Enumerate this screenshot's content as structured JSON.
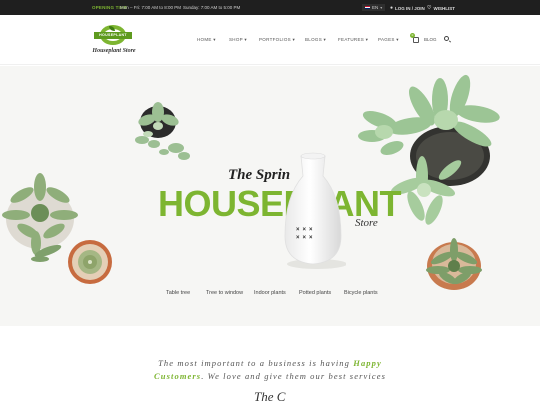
{
  "topbar": {
    "hours_title": "OPENING TIME",
    "hours_week": "Mon – Fri: 7:00 AM to 8:00 PM",
    "hours_weekend": "Sunday: 7:00 AM to 5:00 PM",
    "language": "EN",
    "login_label": "LOG IN / JOIN",
    "wishlist_label": "WISHLIST"
  },
  "header": {
    "logo_badge": "HOUSEPLANT",
    "logo_text": "Houseplant Store",
    "nav": [
      {
        "label": "HOME ▾"
      },
      {
        "label": "SHOP ▾"
      },
      {
        "label": "PORTFOLIOS ▾"
      },
      {
        "label": "BLOGS ▾"
      },
      {
        "label": "FEATURES ▾"
      },
      {
        "label": "PAGES ▾"
      }
    ],
    "cart_count": "0",
    "blog_label": "BLOG"
  },
  "hero": {
    "title_line1": "The Sprin",
    "title_line2": "HOUSEPLANT",
    "title_line3": "Store",
    "links": [
      "Table tree",
      "Tree to window",
      "Indoor plants",
      "Potted plants",
      "Bicycle plants"
    ]
  },
  "quote": {
    "part1": "The most important to a business is having",
    "highlight1": "Happy",
    "highlight2": "Customers",
    "part2": ". We love and give them our best services"
  },
  "signature": "The C",
  "colors": {
    "accent": "#7db531",
    "topbar_bg": "#1f1f1f",
    "hero_bg": "#f6f6f4"
  },
  "icons": {
    "user": "user-icon",
    "heart": "heart-icon",
    "cart": "cart-icon",
    "search": "search-icon"
  }
}
